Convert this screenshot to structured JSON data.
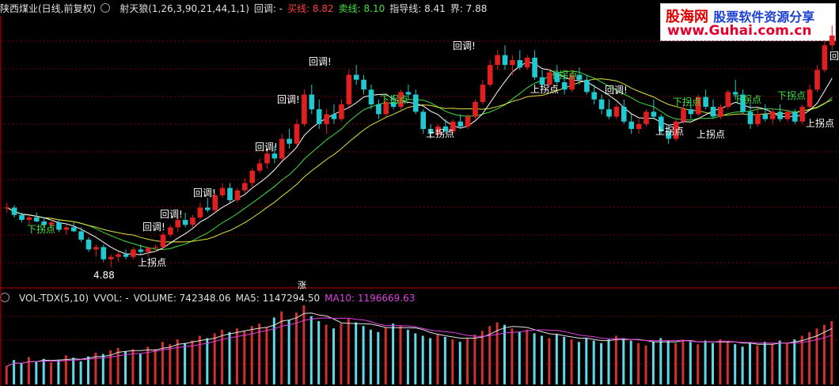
{
  "header": {
    "stock": "陕西煤业(日线,前复权)",
    "indicator": "射天狼(1,26,3,90,21,44,1,1)",
    "pullback_label": "回调: -",
    "buy_label": "买线: 8.82",
    "sell_label": "卖线: 8.10",
    "guide_label": "指导线: 8.41",
    "bound_label": "界: 7.88",
    "colors": {
      "buy": "#ff4040",
      "sell": "#40e040",
      "text": "#e0e0e0"
    }
  },
  "volume_header": {
    "name": "VOL-TDX(5,10)",
    "vvol": "VVOL: -",
    "volume": "VOLUME: 742348.06",
    "ma5": "MA5: 1147294.50",
    "ma10": "MA10: 1196669.63",
    "colors": {
      "ma5": "#e0e0e0",
      "ma10": "#e040e0"
    }
  },
  "watermark": {
    "cn": "股海网",
    "slogan": "股票软件资源分享",
    "url": "www.Guhai.com.cn"
  },
  "marker": "涨",
  "chart_data": {
    "type": "candlestick",
    "title": "",
    "ylim": [
      4.5,
      10.0
    ],
    "low_label": "4.88",
    "annotations": {
      "pullback": "回调!",
      "up_turn": "上拐点",
      "down_turn": "下拐点"
    },
    "candles": [
      [
        6.1,
        6.2,
        6.0,
        6.1
      ],
      [
        6.1,
        6.15,
        5.9,
        5.95
      ],
      [
        5.95,
        6.0,
        5.8,
        5.85
      ],
      [
        5.85,
        5.95,
        5.75,
        5.9
      ],
      [
        5.9,
        6.0,
        5.8,
        5.82
      ],
      [
        5.82,
        5.9,
        5.7,
        5.75
      ],
      [
        5.75,
        5.85,
        5.65,
        5.8
      ],
      [
        5.8,
        5.85,
        5.6,
        5.65
      ],
      [
        5.65,
        5.75,
        5.55,
        5.7
      ],
      [
        5.7,
        5.8,
        5.6,
        5.62
      ],
      [
        5.62,
        5.7,
        5.4,
        5.45
      ],
      [
        5.45,
        5.5,
        5.2,
        5.25
      ],
      [
        5.25,
        5.35,
        5.1,
        5.3
      ],
      [
        5.3,
        5.35,
        5.0,
        5.05
      ],
      [
        5.05,
        5.15,
        4.88,
        5.1
      ],
      [
        5.1,
        5.2,
        5.0,
        5.15
      ],
      [
        5.15,
        5.25,
        5.05,
        5.1
      ],
      [
        5.1,
        5.3,
        5.05,
        5.25
      ],
      [
        5.25,
        5.35,
        5.15,
        5.2
      ],
      [
        5.2,
        5.3,
        5.1,
        5.28
      ],
      [
        5.28,
        5.35,
        5.2,
        5.3
      ],
      [
        5.3,
        5.6,
        5.25,
        5.55
      ],
      [
        5.55,
        5.75,
        5.5,
        5.7
      ],
      [
        5.7,
        5.9,
        5.6,
        5.85
      ],
      [
        5.85,
        6.0,
        5.7,
        5.75
      ],
      [
        5.75,
        5.95,
        5.7,
        5.9
      ],
      [
        5.9,
        6.2,
        5.85,
        6.1
      ],
      [
        6.1,
        6.3,
        6.0,
        6.05
      ],
      [
        6.05,
        6.4,
        6.0,
        6.35
      ],
      [
        6.35,
        6.6,
        6.3,
        6.5
      ],
      [
        6.5,
        6.6,
        6.2,
        6.25
      ],
      [
        6.25,
        6.5,
        6.2,
        6.45
      ],
      [
        6.45,
        6.7,
        6.4,
        6.6
      ],
      [
        6.6,
        6.9,
        6.5,
        6.85
      ],
      [
        6.85,
        7.1,
        6.8,
        7.0
      ],
      [
        7.0,
        7.3,
        6.9,
        7.2
      ],
      [
        7.2,
        7.35,
        7.0,
        7.1
      ],
      [
        7.1,
        7.6,
        7.05,
        7.5
      ],
      [
        7.5,
        7.7,
        7.3,
        7.4
      ],
      [
        7.4,
        7.9,
        7.35,
        7.8
      ],
      [
        7.8,
        8.5,
        7.75,
        8.4
      ],
      [
        8.4,
        8.6,
        8.0,
        8.1
      ],
      [
        8.1,
        8.3,
        7.7,
        7.8
      ],
      [
        7.8,
        8.1,
        7.6,
        8.0
      ],
      [
        8.0,
        8.2,
        7.8,
        7.9
      ],
      [
        7.9,
        8.3,
        7.85,
        8.2
      ],
      [
        8.2,
        8.9,
        8.15,
        8.8
      ],
      [
        8.8,
        9.0,
        8.6,
        8.7
      ],
      [
        8.7,
        8.8,
        8.4,
        8.5
      ],
      [
        8.5,
        8.6,
        8.1,
        8.2
      ],
      [
        8.2,
        8.3,
        7.9,
        8.0
      ],
      [
        8.0,
        8.3,
        7.95,
        8.25
      ],
      [
        8.25,
        8.4,
        8.1,
        8.15
      ],
      [
        8.15,
        8.5,
        8.1,
        8.45
      ],
      [
        8.45,
        8.6,
        8.3,
        8.4
      ],
      [
        8.4,
        8.5,
        8.0,
        8.05
      ],
      [
        8.05,
        8.1,
        7.6,
        7.7
      ],
      [
        7.7,
        7.8,
        7.5,
        7.6
      ],
      [
        7.6,
        7.8,
        7.55,
        7.75
      ],
      [
        7.75,
        7.9,
        7.6,
        7.65
      ],
      [
        7.65,
        7.9,
        7.6,
        7.85
      ],
      [
        7.85,
        8.0,
        7.7,
        7.75
      ],
      [
        7.75,
        8.0,
        7.7,
        7.95
      ],
      [
        7.95,
        8.3,
        7.9,
        8.25
      ],
      [
        8.25,
        8.7,
        8.2,
        8.6
      ],
      [
        8.6,
        9.1,
        8.55,
        9.0
      ],
      [
        9.0,
        9.3,
        8.9,
        9.2
      ],
      [
        9.2,
        9.4,
        8.9,
        9.0
      ],
      [
        9.0,
        9.2,
        8.8,
        9.1
      ],
      [
        9.1,
        9.3,
        8.9,
        8.95
      ],
      [
        8.95,
        9.2,
        8.9,
        9.15
      ],
      [
        9.15,
        9.3,
        8.7,
        8.75
      ],
      [
        8.75,
        8.9,
        8.5,
        8.6
      ],
      [
        8.6,
        8.9,
        8.55,
        8.85
      ],
      [
        8.85,
        9.0,
        8.6,
        8.65
      ],
      [
        8.65,
        8.8,
        8.4,
        8.5
      ],
      [
        8.5,
        8.9,
        8.45,
        8.8
      ],
      [
        8.8,
        8.95,
        8.6,
        8.7
      ],
      [
        8.7,
        8.8,
        8.4,
        8.45
      ],
      [
        8.45,
        8.6,
        8.2,
        8.3
      ],
      [
        8.3,
        8.4,
        8.0,
        8.1
      ],
      [
        8.1,
        8.3,
        7.9,
        7.95
      ],
      [
        7.95,
        8.2,
        7.9,
        8.15
      ],
      [
        8.15,
        8.3,
        7.8,
        7.85
      ],
      [
        7.85,
        8.0,
        7.6,
        7.7
      ],
      [
        7.7,
        7.9,
        7.6,
        7.8
      ],
      [
        7.8,
        8.1,
        7.75,
        8.05
      ],
      [
        8.05,
        8.3,
        7.9,
        7.95
      ],
      [
        7.95,
        8.0,
        7.6,
        7.65
      ],
      [
        7.65,
        7.8,
        7.4,
        7.5
      ],
      [
        7.5,
        7.9,
        7.45,
        7.85
      ],
      [
        7.85,
        8.2,
        7.8,
        8.1
      ],
      [
        8.1,
        8.3,
        7.9,
        8.0
      ],
      [
        8.0,
        8.4,
        7.95,
        8.35
      ],
      [
        8.35,
        8.5,
        8.1,
        8.15
      ],
      [
        8.15,
        8.3,
        7.9,
        7.95
      ],
      [
        7.95,
        8.2,
        7.9,
        8.15
      ],
      [
        8.15,
        8.5,
        8.1,
        8.45
      ],
      [
        8.45,
        8.7,
        8.3,
        8.4
      ],
      [
        8.4,
        8.5,
        8.0,
        8.05
      ],
      [
        8.05,
        8.2,
        7.7,
        7.8
      ],
      [
        7.8,
        8.1,
        7.75,
        8.0
      ],
      [
        8.0,
        8.2,
        7.85,
        7.9
      ],
      [
        7.9,
        8.1,
        7.8,
        8.05
      ],
      [
        8.05,
        8.2,
        7.85,
        7.9
      ],
      [
        7.9,
        8.1,
        7.85,
        8.05
      ],
      [
        8.05,
        8.1,
        7.8,
        7.85
      ],
      [
        7.85,
        8.2,
        7.8,
        8.15
      ],
      [
        8.15,
        8.6,
        8.1,
        8.5
      ],
      [
        8.5,
        9.0,
        8.45,
        8.9
      ],
      [
        8.9,
        9.5,
        8.85,
        9.4
      ],
      [
        9.4,
        9.8,
        9.3,
        9.6
      ]
    ],
    "volume": [
      30,
      40,
      35,
      45,
      38,
      42,
      36,
      40,
      48,
      44,
      38,
      46,
      52,
      50,
      56,
      60,
      54,
      58,
      50,
      62,
      58,
      70,
      66,
      74,
      68,
      72,
      80,
      76,
      84,
      90,
      86,
      92,
      88,
      96,
      100,
      94,
      110,
      120,
      106,
      118,
      130,
      112,
      104,
      98,
      92,
      100,
      108,
      102,
      96,
      90,
      86,
      94,
      100,
      96,
      90,
      84,
      80,
      76,
      82,
      78,
      74,
      70,
      76,
      82,
      88,
      96,
      102,
      98,
      92,
      86,
      90,
      84,
      80,
      76,
      82,
      78,
      74,
      70,
      76,
      72,
      68,
      74,
      80,
      76,
      72,
      68,
      64,
      70,
      76,
      72,
      68,
      74,
      70,
      66,
      72,
      68,
      74,
      70,
      66,
      62,
      68,
      64,
      70,
      66,
      72,
      68,
      74,
      80,
      86,
      92,
      98,
      104
    ]
  }
}
